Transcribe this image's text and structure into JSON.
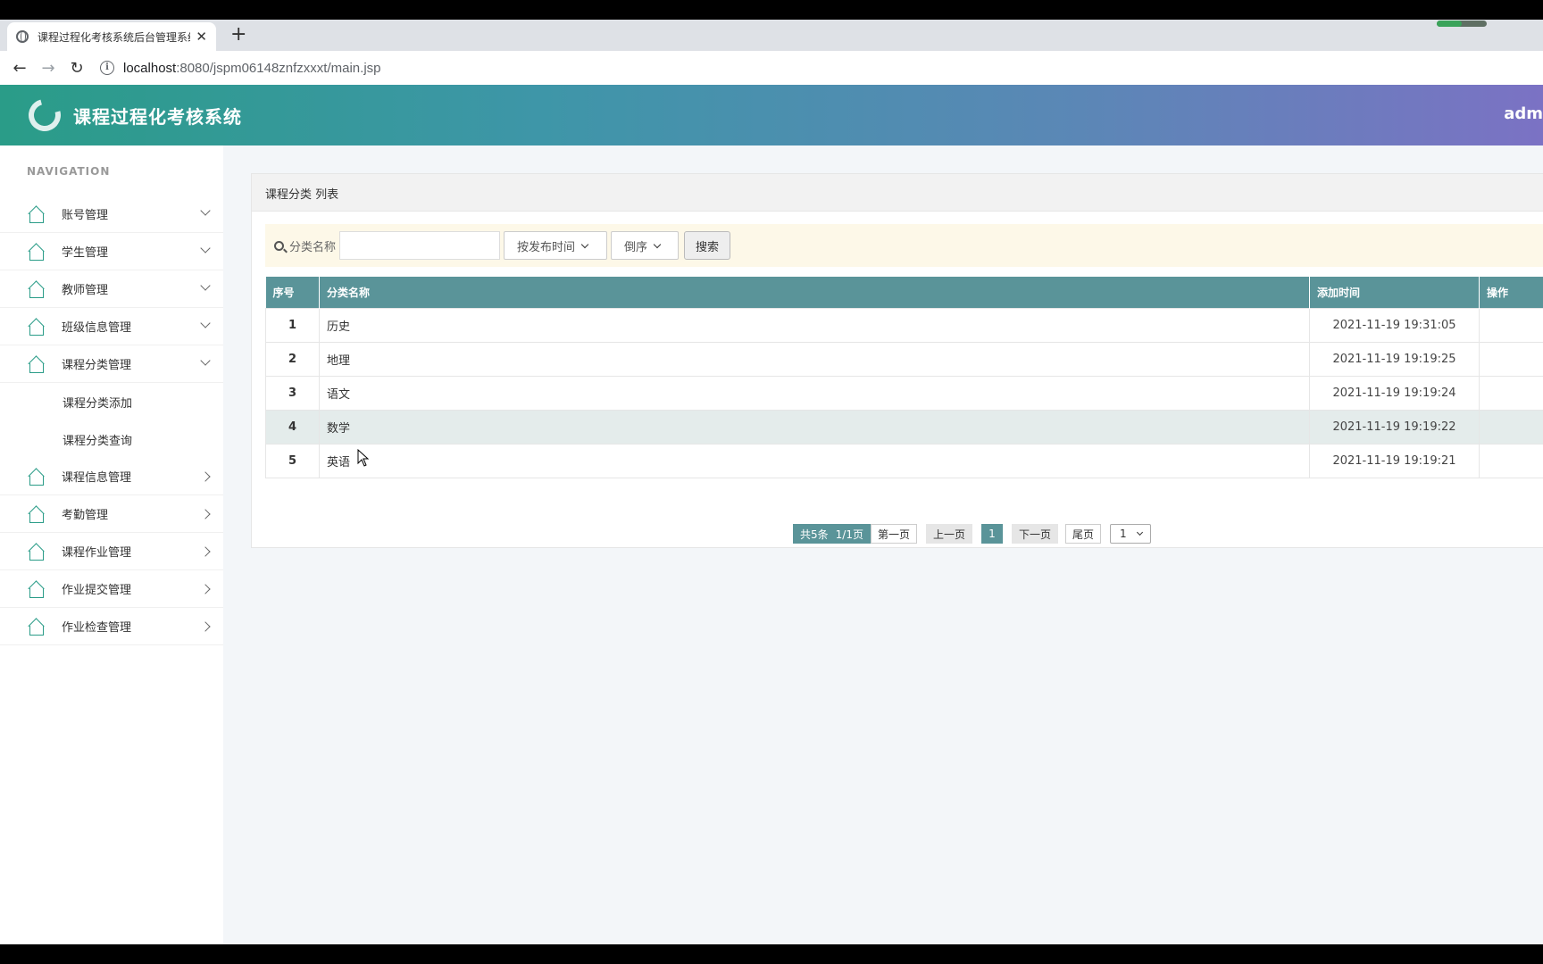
{
  "browser": {
    "tab_title": "课程过程化考核系统后台管理系统",
    "tab_close": "✕",
    "new_tab": "+",
    "url_host": "localhost",
    "url_rest": ":8080/jspm06148znfzxxxt/main.jsp"
  },
  "header": {
    "title": "课程过程化考核系统",
    "user": "adm"
  },
  "sidebar": {
    "heading": "NAVIGATION",
    "items": [
      {
        "label": "账号管理"
      },
      {
        "label": "学生管理"
      },
      {
        "label": "教师管理"
      },
      {
        "label": "班级信息管理"
      },
      {
        "label": "课程分类管理"
      },
      {
        "label": "课程信息管理"
      },
      {
        "label": "考勤管理"
      },
      {
        "label": "课程作业管理"
      },
      {
        "label": "作业提交管理"
      },
      {
        "label": "作业检查管理"
      }
    ],
    "subitems": [
      {
        "label": "课程分类添加"
      },
      {
        "label": "课程分类查询"
      }
    ]
  },
  "panel": {
    "title": "课程分类 列表"
  },
  "search": {
    "label": "分类名称",
    "value": "",
    "sort_field": "按发布时间",
    "sort_order": "倒序",
    "button": "搜索"
  },
  "table": {
    "headers": [
      "序号",
      "分类名称",
      "添加时间",
      "操作"
    ],
    "rows": [
      {
        "no": "1",
        "name": "历史",
        "time": "2021-11-19 19:31:05"
      },
      {
        "no": "2",
        "name": "地理",
        "time": "2021-11-19 19:19:25"
      },
      {
        "no": "3",
        "name": "语文",
        "time": "2021-11-19 19:19:24"
      },
      {
        "no": "4",
        "name": "数学",
        "time": "2021-11-19 19:19:22"
      },
      {
        "no": "5",
        "name": "英语",
        "time": "2021-11-19 19:19:21"
      }
    ]
  },
  "pager": {
    "total": "共5条",
    "pages": "1/1页",
    "first": "第一页",
    "prev": "上一页",
    "current": "1",
    "next": "下一页",
    "last": "尾页",
    "jump": "1"
  }
}
